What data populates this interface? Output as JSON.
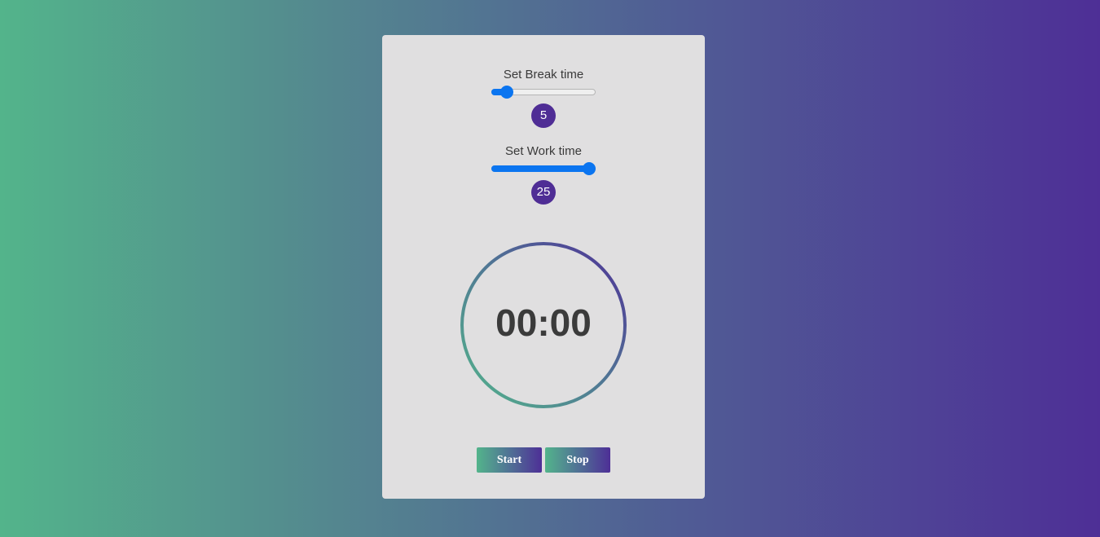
{
  "break_setting": {
    "label": "Set Break time",
    "value": "5",
    "slider_fraction": 0.1
  },
  "work_setting": {
    "label": "Set Work time",
    "value": "25",
    "slider_fraction": 1.0
  },
  "timer": {
    "display": "00:00"
  },
  "controls": {
    "start_label": "Start",
    "stop_label": "Stop"
  },
  "colors": {
    "gradient_start": "#53b48b",
    "gradient_end": "#4e2f96",
    "card_background": "#e0dfe0",
    "slider_accent": "#0b75f0",
    "badge_background": "#4f2d95"
  }
}
